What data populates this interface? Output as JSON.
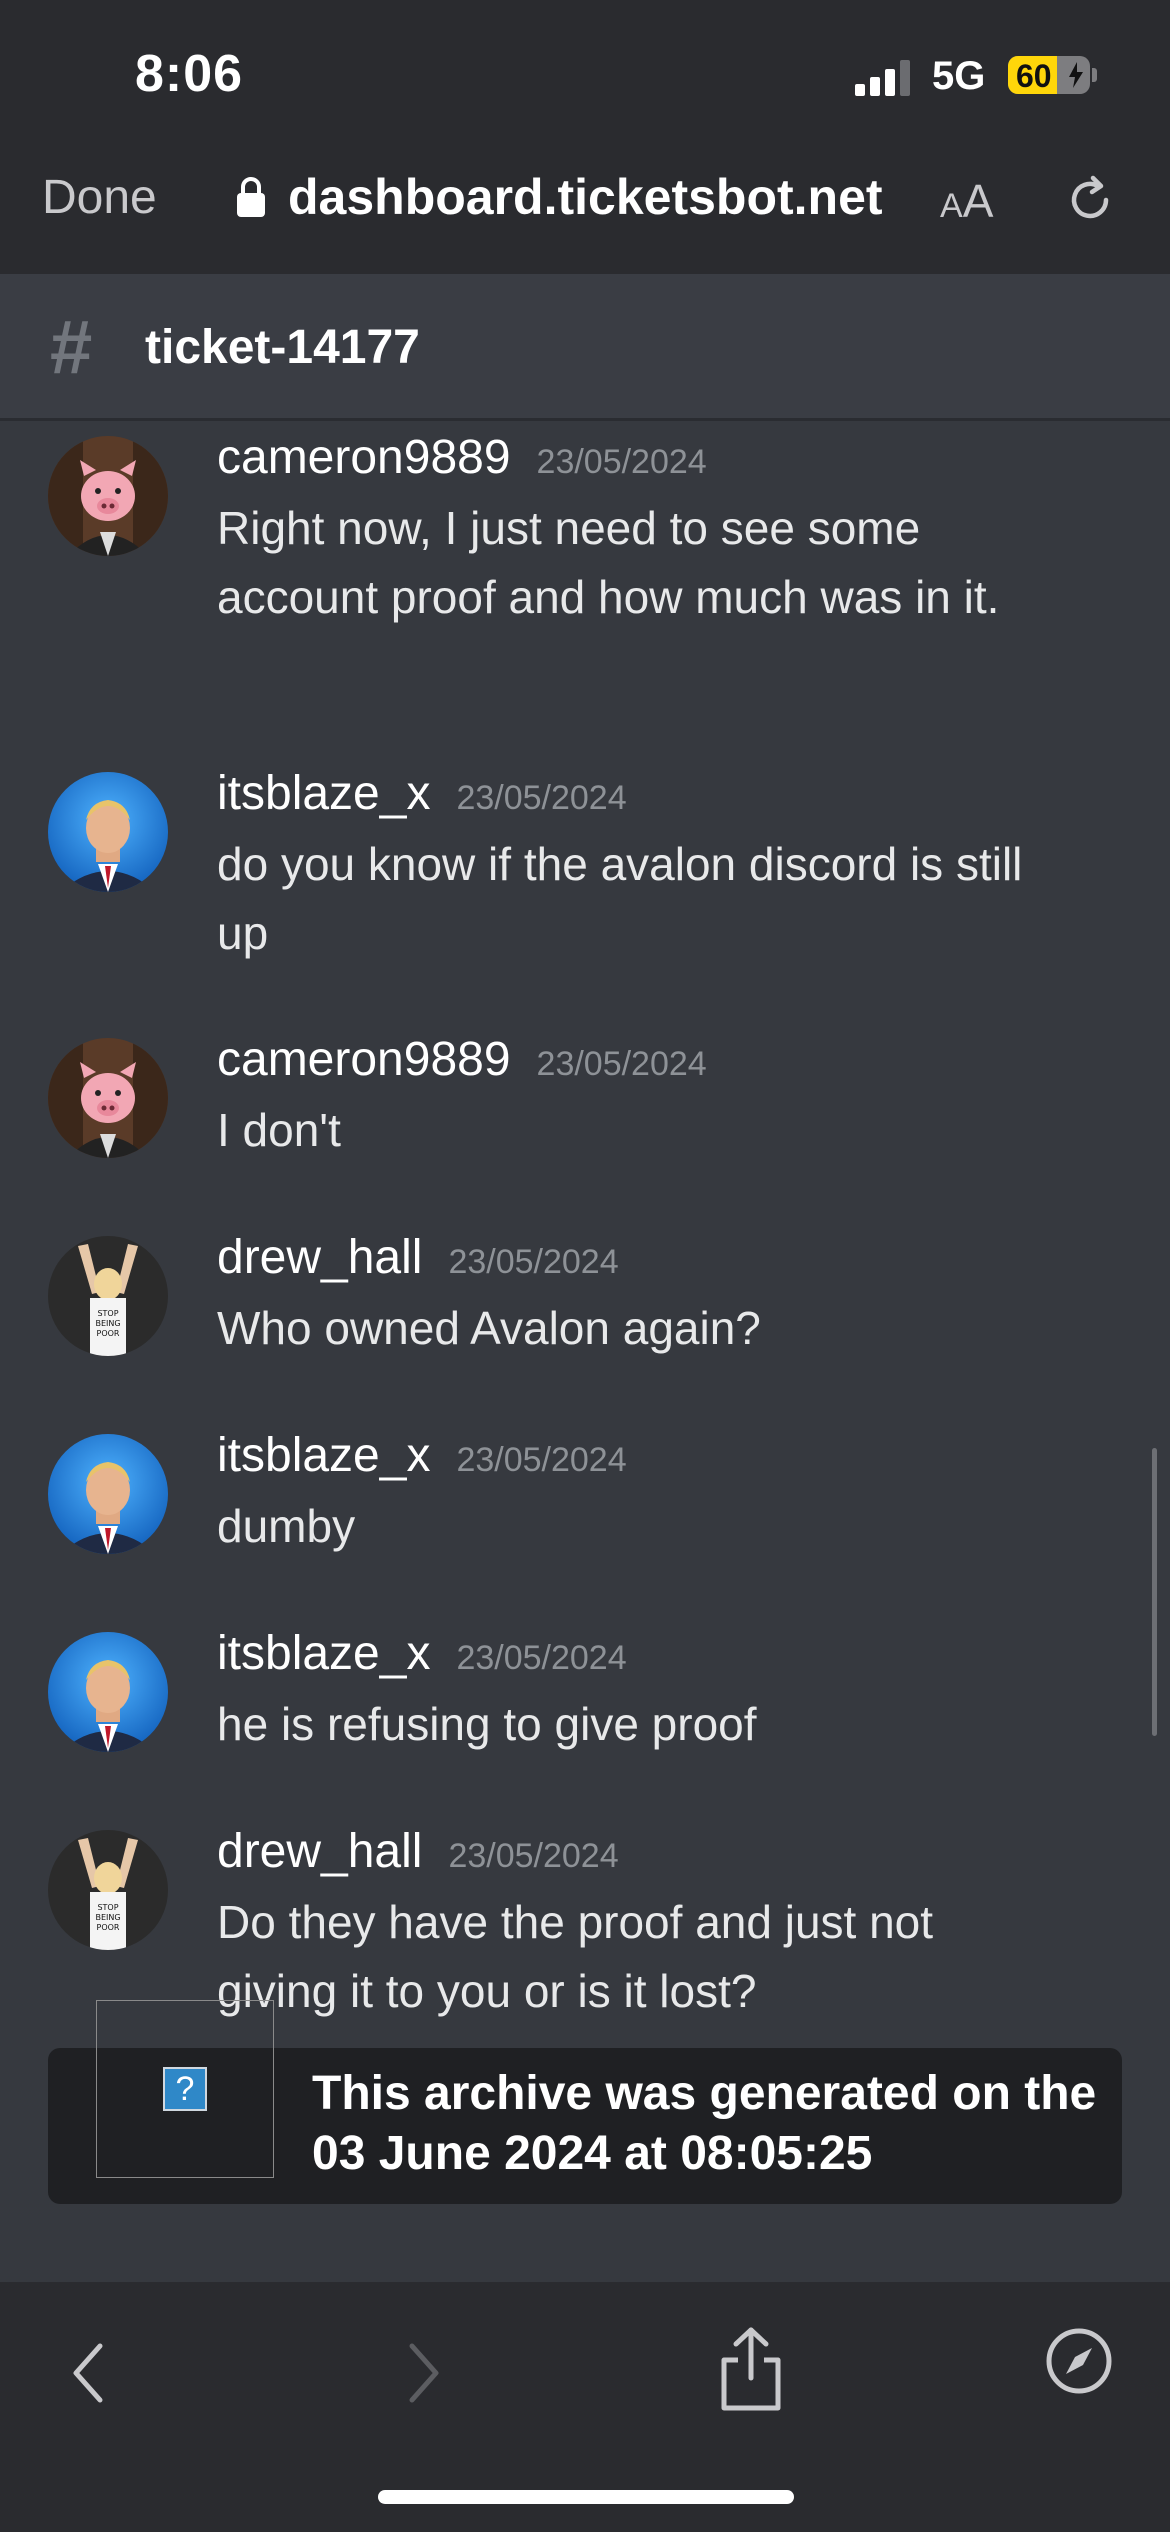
{
  "status_bar": {
    "time": "8:06",
    "network": "5G",
    "battery": "60",
    "battery_level": 0.6
  },
  "browser": {
    "done_label": "Done",
    "url": "dashboard.ticketsbot.net",
    "aa_small": "A",
    "aa_large": "A"
  },
  "channel": {
    "hash": "#",
    "name": "ticket-14177"
  },
  "messages": [
    {
      "author": "cameron9889",
      "timestamp": "23/05/2024",
      "text": "Right now, I just need to see some account proof and how much was in it.",
      "avatar": "pig-avatar"
    },
    {
      "author": "itsblaze_x",
      "timestamp": "23/05/2024",
      "text": "do you know if the avalon discord is still up",
      "avatar": "suit-avatar"
    },
    {
      "author": "cameron9889",
      "timestamp": "23/05/2024",
      "text": "I don't",
      "avatar": "pig-avatar"
    },
    {
      "author": "drew_hall",
      "timestamp": "23/05/2024",
      "text": "Who owned Avalon again?",
      "avatar": "sign-avatar"
    },
    {
      "author": "itsblaze_x",
      "timestamp": "23/05/2024",
      "text": "dumby",
      "avatar": "suit-avatar"
    },
    {
      "author": "itsblaze_x",
      "timestamp": "23/05/2024",
      "text": "he is refusing to give proof",
      "avatar": "suit-avatar"
    },
    {
      "author": "drew_hall",
      "timestamp": "23/05/2024",
      "text": "Do they have the proof and just not giving it to you or is it lost?",
      "avatar": "sign-avatar"
    }
  ],
  "footer": {
    "text": "This archive was generated on the 03 June 2024 at 08:05:25",
    "image_placeholder": "?"
  },
  "toolbar": {
    "icons": [
      "back-icon",
      "forward-icon",
      "share-icon",
      "compass-icon"
    ]
  }
}
